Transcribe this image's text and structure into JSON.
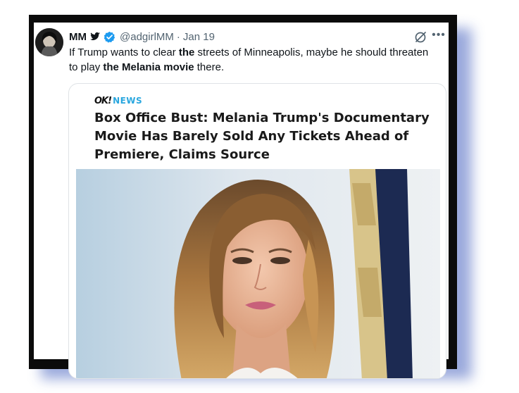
{
  "tweet": {
    "display_name": "MM",
    "handle": "@adgirlMM",
    "separator": "·",
    "date": "Jan 19",
    "text_parts": [
      {
        "t": "If Trump wants to clear ",
        "b": false
      },
      {
        "t": "the",
        "b": true
      },
      {
        "t": " streets of Minneapolis, maybe he should threaten to play ",
        "b": false
      },
      {
        "t": "the Melania movie",
        "b": true
      },
      {
        "t": " there.",
        "b": false
      }
    ],
    "icons": [
      "bird-icon",
      "verified-icon",
      "grok-icon",
      "more-icon"
    ]
  },
  "article": {
    "brand_ok": "OK!",
    "brand_news": "NEWS",
    "headline": "Box Office Bust: Melania Trump's Documentary Movie Has Barely Sold Any Tickets Ahead of Premiere, Claims Source"
  },
  "colors": {
    "frame": "#0b0b0b",
    "shadow": "#8fa0d8",
    "verified": "#1d9bf0",
    "brand_news": "#2aa7df",
    "secondary_text": "#536471"
  }
}
